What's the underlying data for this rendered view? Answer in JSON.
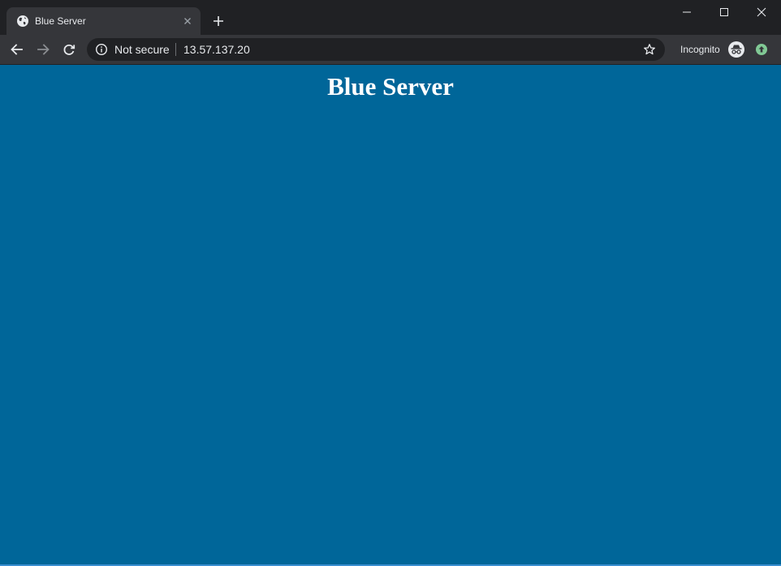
{
  "browser": {
    "tab": {
      "title": "Blue Server",
      "favicon": "globe-icon"
    },
    "toolbar": {
      "security_label": "Not secure",
      "url": "13.57.137.20",
      "incognito_label": "Incognito"
    }
  },
  "page": {
    "heading": "Blue Server",
    "background_color": "#006699",
    "heading_color": "#ffffff"
  },
  "icons": {
    "back": "back-arrow-icon",
    "forward": "forward-arrow-icon",
    "reload": "reload-icon",
    "info": "info-icon",
    "star": "star-icon",
    "incognito": "incognito-icon",
    "update": "update-icon"
  }
}
